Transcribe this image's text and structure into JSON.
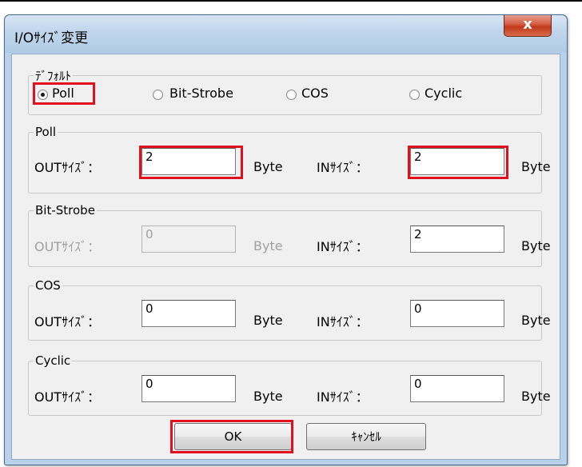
{
  "window": {
    "title": "I/Oｻｲｽﾞ変更",
    "close_label": "x"
  },
  "default_group": {
    "legend": "ﾃﾞﾌｫﾙﾄ",
    "options": [
      {
        "label": "Poll",
        "selected": true
      },
      {
        "label": "Bit-Strobe",
        "selected": false
      },
      {
        "label": "COS",
        "selected": false
      },
      {
        "label": "Cyclic",
        "selected": false
      }
    ]
  },
  "groups": [
    {
      "legend": "Poll",
      "out_label": "OUTｻｲｽﾞ：",
      "out_value": "2",
      "out_enabled": true,
      "out_unit": "Byte",
      "in_label": "INｻｲｽﾞ：",
      "in_value": "2",
      "in_unit": "Byte"
    },
    {
      "legend": "Bit-Strobe",
      "out_label": "OUTｻｲｽﾞ：",
      "out_value": "0",
      "out_enabled": false,
      "out_unit": "Byte",
      "in_label": "INｻｲｽﾞ：",
      "in_value": "2",
      "in_unit": "Byte"
    },
    {
      "legend": "COS",
      "out_label": "OUTｻｲｽﾞ：",
      "out_value": "0",
      "out_enabled": true,
      "out_unit": "Byte",
      "in_label": "INｻｲｽﾞ：",
      "in_value": "0",
      "in_unit": "Byte"
    },
    {
      "legend": "Cyclic",
      "out_label": "OUTｻｲｽﾞ：",
      "out_value": "0",
      "out_enabled": true,
      "out_unit": "Byte",
      "in_label": "INｻｲｽﾞ：",
      "in_value": "0",
      "in_unit": "Byte"
    }
  ],
  "buttons": {
    "ok": "OK",
    "cancel": "ｷｬﾝｾﾙ"
  },
  "colors": {
    "highlight": "#e0101e",
    "title_bar": "#bfd5ec",
    "close_button": "#c2381b",
    "dialog_bg": "#f0f0f0"
  }
}
